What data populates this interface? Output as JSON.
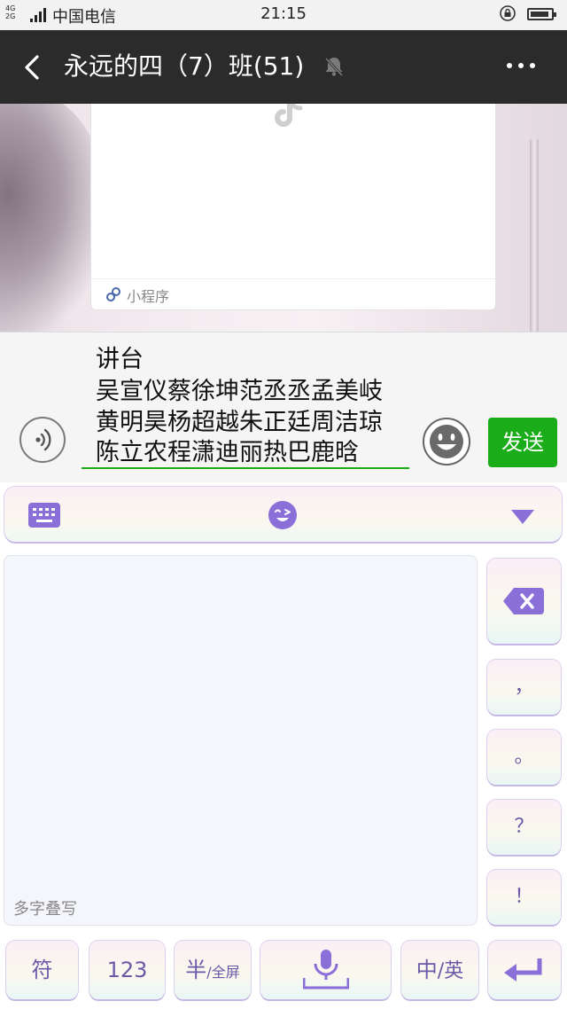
{
  "status_bar": {
    "network": "4G\n2G",
    "carrier": "中国电信",
    "time": "21:15",
    "battery_level": 0.9
  },
  "title_bar": {
    "title": "永远的四（7）班(51)"
  },
  "chat": {
    "mini_program_label": "小程序"
  },
  "input": {
    "lines": [
      "讲台",
      "吴宣仪蔡徐坤范丞丞孟美岐",
      "黄明昊杨超越朱正廷周洁琼",
      "陈立农程潇迪丽热巴鹿晗"
    ],
    "send_label": "发送"
  },
  "keyboard": {
    "handwriting_hint": "多字叠写",
    "punctuation": [
      "，",
      "。",
      "？",
      "！"
    ],
    "bottom": {
      "symbol": "符",
      "numbers": "123",
      "half_main": "半",
      "half_sub": "/全屏",
      "lang_main": "中",
      "lang_sub": "/英"
    }
  },
  "colors": {
    "accent_green": "#1aad19",
    "keyboard_purple": "#8a6fd8",
    "title_bar_bg": "#2b2b2b"
  }
}
